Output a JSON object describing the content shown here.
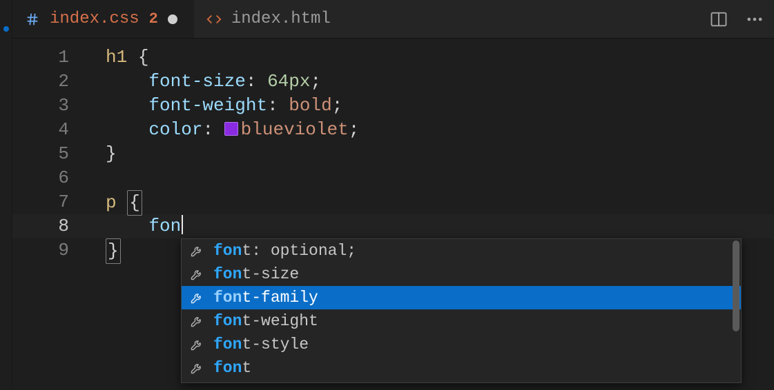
{
  "tabs": {
    "active": {
      "name": "index.css",
      "problems": "2",
      "icon": "hash-icon",
      "dirty": true
    },
    "other": {
      "name": "index.html",
      "icon": "code-icon"
    }
  },
  "actions": {
    "split": "split-editor-icon",
    "more": "more-icon"
  },
  "gutter": {
    "lines": [
      "1",
      "2",
      "3",
      "4",
      "5",
      "6",
      "7",
      "8",
      "9"
    ],
    "currentIndex": 7
  },
  "code": {
    "l1": {
      "sel": "h1",
      "brace": " {"
    },
    "l2": {
      "indent": "    ",
      "prop": "font-size",
      "colon": ": ",
      "num": "64px",
      "semi": ";"
    },
    "l3": {
      "indent": "    ",
      "prop": "font-weight",
      "colon": ": ",
      "val": "bold",
      "semi": ";"
    },
    "l4": {
      "indent": "    ",
      "prop": "color",
      "colon": ": ",
      "val": "blueviolet",
      "semi": ";"
    },
    "l5": {
      "brace": "}"
    },
    "l6": {
      "blank": " "
    },
    "l7": {
      "sel": "p",
      "sp": " ",
      "brace": "{"
    },
    "l8": {
      "indent": "    ",
      "typed": "fon"
    },
    "l9": {
      "brace": "}"
    }
  },
  "color_swatch": "#8a2be2",
  "suggestions": {
    "match": "fon",
    "items": [
      {
        "match": "fon",
        "rest": "t: optional;"
      },
      {
        "match": "fon",
        "rest": "t-size"
      },
      {
        "match": "fon",
        "rest": "t-family"
      },
      {
        "match": "fon",
        "rest": "t-weight"
      },
      {
        "match": "fon",
        "rest": "t-style"
      },
      {
        "match": "fon",
        "rest": "t"
      }
    ],
    "selectedIndex": 2
  }
}
